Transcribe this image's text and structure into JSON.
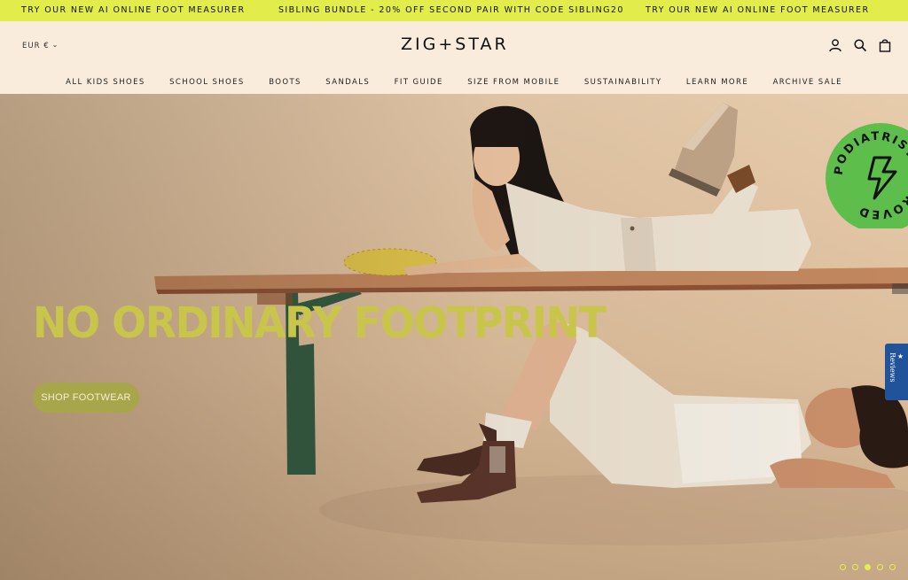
{
  "announcement": {
    "items": [
      "TRY OUR NEW AI ONLINE FOOT MEASURER",
      "SIBLING BUNDLE - 20% OFF SECOND PAIR WITH CODE SIBLING20",
      "TRY OUR NEW AI ONLINE FOOT MEASURER"
    ]
  },
  "header": {
    "currency": "EUR €",
    "logo": "ZIG+STAR",
    "icons": [
      "account-icon",
      "search-icon",
      "bag-icon"
    ]
  },
  "nav": {
    "items": [
      "ALL KIDS SHOES",
      "SCHOOL SHOES",
      "BOOTS",
      "SANDALS",
      "FIT GUIDE",
      "SIZE FROM MOBILE",
      "SUSTAINABILITY",
      "LEARN MORE",
      "ARCHIVE SALE"
    ]
  },
  "hero": {
    "headline": "NO ORDINARY FOOTPRINT",
    "cta_label": "SHOP FOOTWEAR",
    "badge_text": "PODIATRIST APPROVED",
    "slide_count": 5,
    "active_slide": 3,
    "colors": {
      "headline": "#c9c54a",
      "badge": "#5dbe4c",
      "accent": "#e2ed4c"
    }
  },
  "reviews_tab": {
    "label": "Reviews",
    "star": "★"
  }
}
